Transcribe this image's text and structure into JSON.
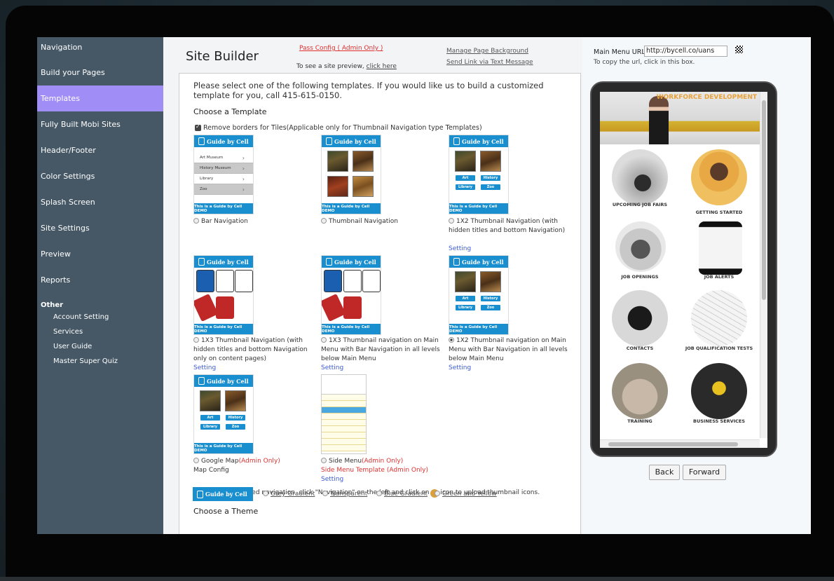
{
  "sidebar": {
    "items": [
      {
        "label": "Navigation"
      },
      {
        "label": "Build your Pages"
      },
      {
        "label": "Templates"
      },
      {
        "label": "Fully Built Mobi Sites"
      },
      {
        "label": "Header/Footer"
      },
      {
        "label": "Color Settings"
      },
      {
        "label": "Splash Screen"
      },
      {
        "label": "Site Settings"
      },
      {
        "label": "Preview"
      },
      {
        "label": "Reports"
      }
    ],
    "other_heading": "Other",
    "sub_items": [
      {
        "label": "Account Setting"
      },
      {
        "label": "Services"
      },
      {
        "label": "User Guide"
      },
      {
        "label": "Master Super Quiz"
      }
    ],
    "active_color": "#a08ef6"
  },
  "header": {
    "title": "Site Builder",
    "pass_config": "Pass Config ( Admin Only )",
    "preview_prefix": "To see a site preview, ",
    "preview_link": "click here",
    "manage_bg": "Manage Page Background",
    "send_link": "Send Link via Text Message"
  },
  "panel": {
    "intro": "Please select one of the following templates. If you would like us to build a customized template for you, call 415-615-0150.",
    "choose_template": "Choose a Template",
    "remove_borders": "Remove borders for Tiles(Applicable only for Thumbnail Navigation type Templates)",
    "brand": "Guide by Cell",
    "footer_text": "This is a Guide by Cell DEMO",
    "bar_items": [
      "Art Museum",
      "History Museum",
      "Library",
      "Zoo"
    ],
    "mini_buttons": [
      "Art",
      "History",
      "Library",
      "Zoo"
    ],
    "thumb_labels": [
      "Art",
      "History",
      "Library",
      "Zoo"
    ],
    "templates": {
      "t1": "Bar Navigation",
      "t2": "Thumbnail Navigation",
      "t3": "1X2 Thumbnail Navigation (with hidden titles and bottom Navigation)",
      "t4": "1X3 Thumbnail Navigation (with hidden titles and bottom Navigation only on content pages)",
      "t5": "1X3 Thumbnail navigation on Main Menu with Bar Navigation in all levels below Main Menu",
      "t6": "1X2 Thumbnail navigation on Main Menu with Bar Navigation in all levels below Main Menu",
      "t7_prefix": "Google Map",
      "t7_admin": "(Admin Only)",
      "t7_config": "Map Config",
      "t8_prefix": "Side Menu",
      "t8_admin": "(Admin Only)",
      "t8_template": "Side Menu Template (Admin Only)"
    },
    "setting_label": "Setting",
    "note_prefix": "For Thumbnail based navigation, click \"Navigation\" on the left and click on ",
    "note_suffix": " icon to upload thumbnail icons.",
    "choose_theme": "Choose a Theme",
    "themes": [
      "Grey Gradient",
      "Transparent",
      "Blue Gradient",
      "Green and Yellow"
    ]
  },
  "right": {
    "url_label": "Main Menu URL:",
    "url_value": "http://bycell.co/uans",
    "copy_hint": "To copy the url, click in this box.",
    "hero_title": "WORKFORCE DEVELOPMENT",
    "tiles": [
      "UPCOMING JOB FAIRS",
      "GETTING STARTED",
      "JOB OPENINGS",
      "JOB ALERTS",
      "CONTACTS",
      "JOB QUALIFICATION TESTS",
      "TRAINING",
      "BUSINESS SERVICES"
    ],
    "back": "Back",
    "forward": "Forward"
  }
}
